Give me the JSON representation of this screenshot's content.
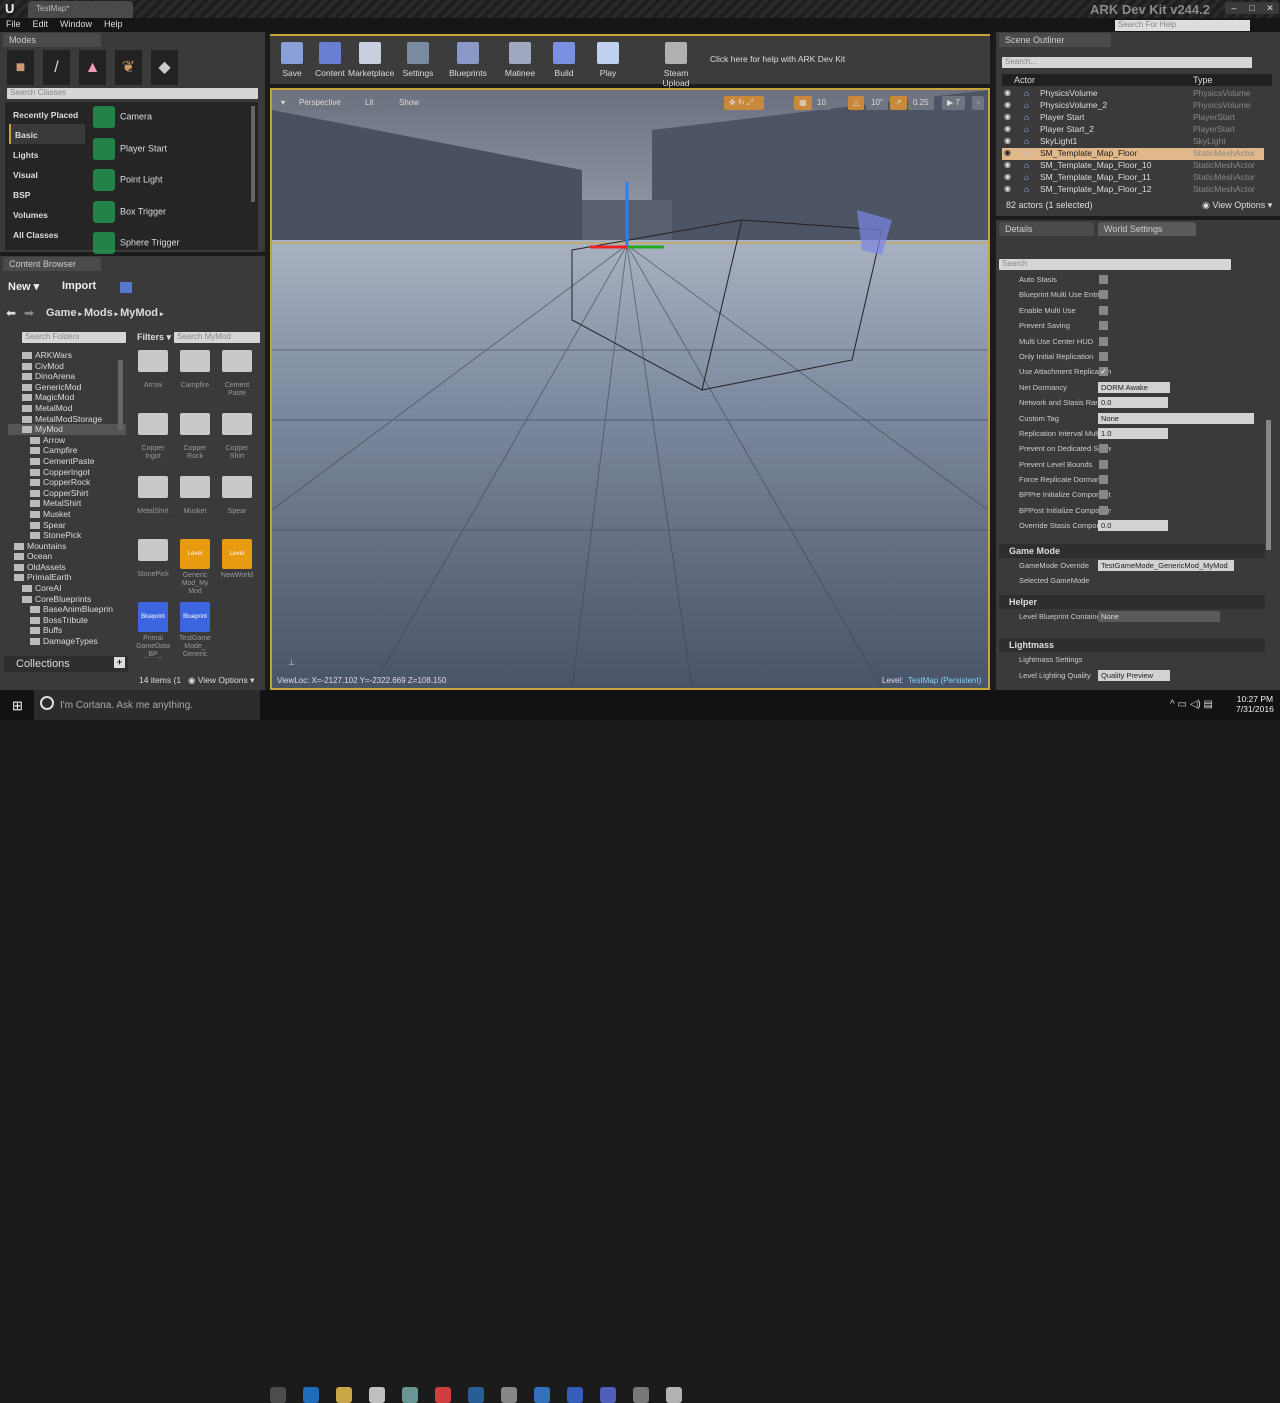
{
  "window": {
    "doc_tab": "TestMap*",
    "app_title": "ARK Dev Kit v244.2",
    "help_search_placeholder": "Search For Help"
  },
  "menu": [
    "File",
    "Edit",
    "Window",
    "Help"
  ],
  "modes": {
    "tab": "Modes",
    "search_placeholder": "Search Classes",
    "categories": [
      "Recently Placed",
      "Basic",
      "Lights",
      "Visual",
      "BSP",
      "Volumes",
      "All Classes"
    ],
    "selected_category": "Basic",
    "classes": [
      "Camera",
      "Player Start",
      "Point Light",
      "Box Trigger",
      "Sphere Trigger"
    ]
  },
  "content_browser": {
    "tab": "Content Browser",
    "new": "New",
    "import": "Import",
    "path": [
      "Game",
      "Mods",
      "MyMod"
    ],
    "search_folders": "Search Folders",
    "filters": "Filters",
    "search_assets": "Search MyMod",
    "folders": [
      {
        "n": "ARKWars",
        "d": 1
      },
      {
        "n": "CivMod",
        "d": 1
      },
      {
        "n": "DinoArena",
        "d": 1
      },
      {
        "n": "GenericMod",
        "d": 1
      },
      {
        "n": "MagicMod",
        "d": 1
      },
      {
        "n": "MetalMod",
        "d": 1
      },
      {
        "n": "MetalModStorage",
        "d": 1
      },
      {
        "n": "MyMod",
        "d": 1,
        "sel": true
      },
      {
        "n": "Arrow",
        "d": 2
      },
      {
        "n": "Campfire",
        "d": 2
      },
      {
        "n": "CementPaste",
        "d": 2
      },
      {
        "n": "CopperIngot",
        "d": 2
      },
      {
        "n": "CopperRock",
        "d": 2
      },
      {
        "n": "CopperShirt",
        "d": 2
      },
      {
        "n": "MetalShirt",
        "d": 2
      },
      {
        "n": "Musket",
        "d": 2
      },
      {
        "n": "Spear",
        "d": 2
      },
      {
        "n": "StonePick",
        "d": 2
      },
      {
        "n": "Mountains",
        "d": 0
      },
      {
        "n": "Ocean",
        "d": 0
      },
      {
        "n": "OldAssets",
        "d": 0
      },
      {
        "n": "PrimalEarth",
        "d": 0
      },
      {
        "n": "CoreAI",
        "d": 1
      },
      {
        "n": "CoreBlueprints",
        "d": 1
      },
      {
        "n": "BaseAnimBlueprin",
        "d": 2
      },
      {
        "n": "BossTribute",
        "d": 2
      },
      {
        "n": "Buffs",
        "d": 2
      },
      {
        "n": "DamageTypes",
        "d": 2
      }
    ],
    "assets": [
      {
        "n": "Arrow",
        "k": "folder"
      },
      {
        "n": "Campfire",
        "k": "folder"
      },
      {
        "n": "Cement Paste",
        "k": "folder"
      },
      {
        "n": "Copper Ingot",
        "k": "folder"
      },
      {
        "n": "Copper Rock",
        "k": "folder"
      },
      {
        "n": "Copper Shirt",
        "k": "folder"
      },
      {
        "n": "MetalShirt",
        "k": "folder"
      },
      {
        "n": "Musket",
        "k": "folder"
      },
      {
        "n": "Spear",
        "k": "folder"
      },
      {
        "n": "StonePick",
        "k": "folder"
      },
      {
        "n": "Generic Mod_My Mod",
        "k": "level",
        "badge": "Level"
      },
      {
        "n": "NewWorld",
        "k": "level",
        "badge": "Level"
      },
      {
        "n": "Primal GameData _BP_",
        "k": "blueprint",
        "badge": "Blueprint"
      },
      {
        "n": "TestGame Mode_ Generic",
        "k": "blueprint",
        "badge": "Blueprint"
      }
    ],
    "collections": "Collections",
    "item_count": "14 items (1",
    "view_options": "View Options"
  },
  "toolbar": [
    {
      "label": "Save",
      "c": "#8aa0d8"
    },
    {
      "label": "Content",
      "c": "#6a7fd0"
    },
    {
      "label": "Marketplace",
      "c": "#c8d0e0"
    },
    {
      "label": "Settings",
      "c": "#7a8aa0"
    },
    {
      "label": "Blueprints",
      "c": "#8a98c8"
    },
    {
      "label": "Matinee",
      "c": "#a0a8c0"
    },
    {
      "label": "Build",
      "c": "#7a90e0"
    },
    {
      "label": "Play",
      "c": "#c0d0f0"
    },
    {
      "label": "Steam Upload",
      "c": "#b0b0b0"
    }
  ],
  "toolbar_help": "Click here for help with ARK Dev Kit",
  "viewport": {
    "perspective": "Perspective",
    "lit": "Lit",
    "show": "Show",
    "grid": "10",
    "angle": "10°",
    "scale": "0.25",
    "camspeed": "7",
    "viewloc": "ViewLoc: X=-2127.102 Y=-2322.669 Z=108.150",
    "level_label": "Level:",
    "level_name": "TestMap (Persistent)"
  },
  "outliner": {
    "tab": "Scene Outliner",
    "search_placeholder": "Search...",
    "col_actor": "Actor",
    "col_type": "Type",
    "rows": [
      {
        "a": "PhysicsVolume",
        "t": "PhysicsVolume"
      },
      {
        "a": "PhysicsVolume_2",
        "t": "PhysicsVolume"
      },
      {
        "a": "Player Start",
        "t": "PlayerStart"
      },
      {
        "a": "Player Start_2",
        "t": "PlayerStart"
      },
      {
        "a": "SkyLight1",
        "t": "SkyLight"
      },
      {
        "a": "SM_Template_Map_Floor",
        "t": "StaticMeshActor",
        "sel": true
      },
      {
        "a": "SM_Template_Map_Floor_10",
        "t": "StaticMeshActor"
      },
      {
        "a": "SM_Template_Map_Floor_11",
        "t": "StaticMeshActor"
      },
      {
        "a": "SM_Template_Map_Floor_12",
        "t": "StaticMeshActor"
      }
    ],
    "count": "82 actors (1 selected)",
    "view_options": "View Options"
  },
  "details": {
    "tab_details": "Details",
    "tab_world": "World Settings",
    "search_placeholder": "Search",
    "props": [
      {
        "l": "Auto Stasis",
        "k": "cb",
        "v": false
      },
      {
        "l": "Blueprint Multi Use Entries",
        "k": "cb",
        "v": false
      },
      {
        "l": "Enable Multi Use",
        "k": "cb",
        "v": false
      },
      {
        "l": "Prevent Saving",
        "k": "cb",
        "v": false
      },
      {
        "l": "Multi Use Center HUD",
        "k": "cb",
        "v": false
      },
      {
        "l": "Only Initial Replication",
        "k": "cb",
        "v": false
      },
      {
        "l": "Use Attachment Replication",
        "k": "cb",
        "v": true
      },
      {
        "l": "Net Dormancy",
        "k": "dd",
        "v": "DORM Awake"
      },
      {
        "l": "Network and Stasis Range",
        "k": "num",
        "v": "0.0"
      },
      {
        "l": "Custom Tag",
        "k": "text",
        "v": "None"
      },
      {
        "l": "Replication Interval Multiplier",
        "k": "num",
        "v": "1.0"
      },
      {
        "l": "Prevent on Dedicated Server",
        "k": "cb",
        "v": false
      },
      {
        "l": "Prevent Level Bounds",
        "k": "cb",
        "v": false
      },
      {
        "l": "Force Replicate Dormant",
        "k": "cb",
        "v": false
      },
      {
        "l": "BPPre Initialize Components",
        "k": "cb",
        "v": false
      },
      {
        "l": "BPPost Initialize Components",
        "k": "cb",
        "v": false
      },
      {
        "l": "Override Stasis Component",
        "k": "num",
        "v": "0.0"
      }
    ],
    "game_mode": {
      "title": "Game Mode",
      "override_label": "GameMode Override",
      "override_value": "TestGameMode_GenericMod_MyMod",
      "selected": "Selected GameMode"
    },
    "helper": {
      "title": "Helper",
      "label": "Level Blueprint Contained",
      "value": "None"
    },
    "lightmass": {
      "title": "Lightmass",
      "settings": "Lightmass Settings",
      "quality_label": "Level Lighting Quality",
      "quality_value": "Quality Preview"
    }
  },
  "taskbar": {
    "cortana": "I'm Cortana. Ask me anything.",
    "time": "10:27 PM",
    "date": "7/31/2016",
    "apps": [
      "task-view",
      "edge",
      "file-explorer",
      "store",
      "steam-alt",
      "chrome",
      "steam",
      "app",
      "app-active",
      "app-blue",
      "discord",
      "epic",
      "unreal"
    ]
  }
}
